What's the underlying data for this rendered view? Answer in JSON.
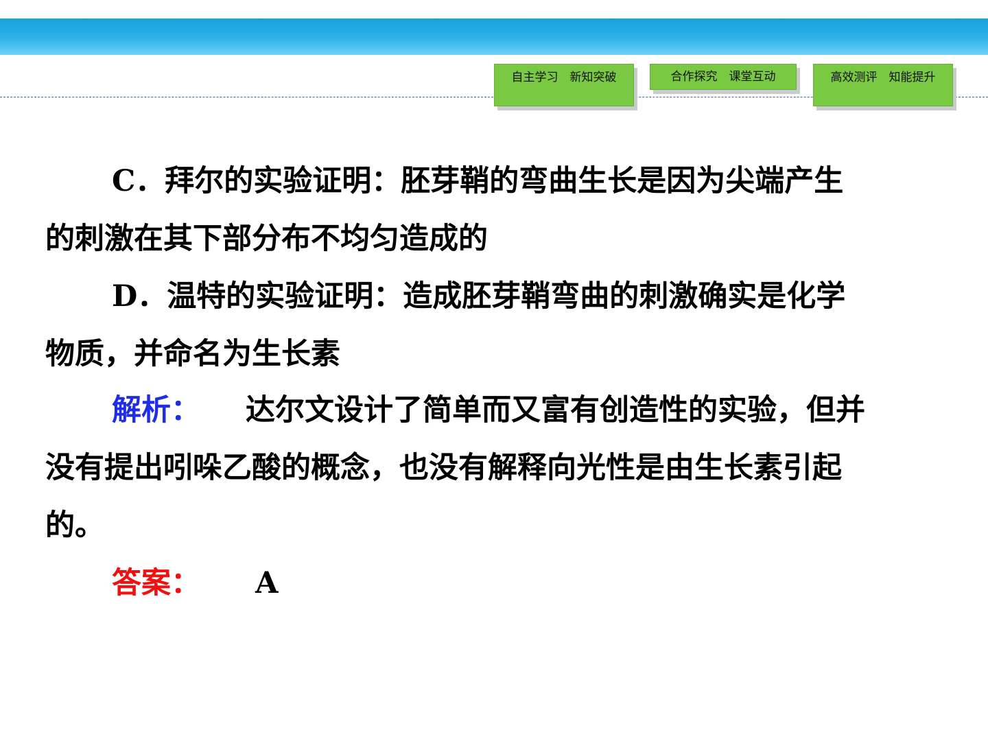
{
  "header": {
    "accent_color": "#2fb2ea",
    "nav_buttons": [
      {
        "label": "自主学习　新知突破"
      },
      {
        "label": "合作探究　课堂互动"
      },
      {
        "label": "高效测评　知能提升"
      }
    ]
  },
  "content": {
    "option_c": {
      "line1": "C．拜尔的实验证明：胚芽鞘的弯曲生长是因为尖端产生",
      "line2": "的刺激在其下部分布不均匀造成的"
    },
    "option_d": {
      "line1": "D．温特的实验证明：造成胚芽鞘弯曲的刺激确实是化学",
      "line2": "物质，并命名为生长素"
    },
    "analysis": {
      "label": "解析：",
      "line1": "达尔文设计了简单而又富有创造性的实验，但并",
      "line2": "没有提出吲哚乙酸的概念，也没有解释向光性是由生长素引起",
      "line3": "的。"
    },
    "answer": {
      "label": "答案：",
      "value": "A"
    }
  }
}
